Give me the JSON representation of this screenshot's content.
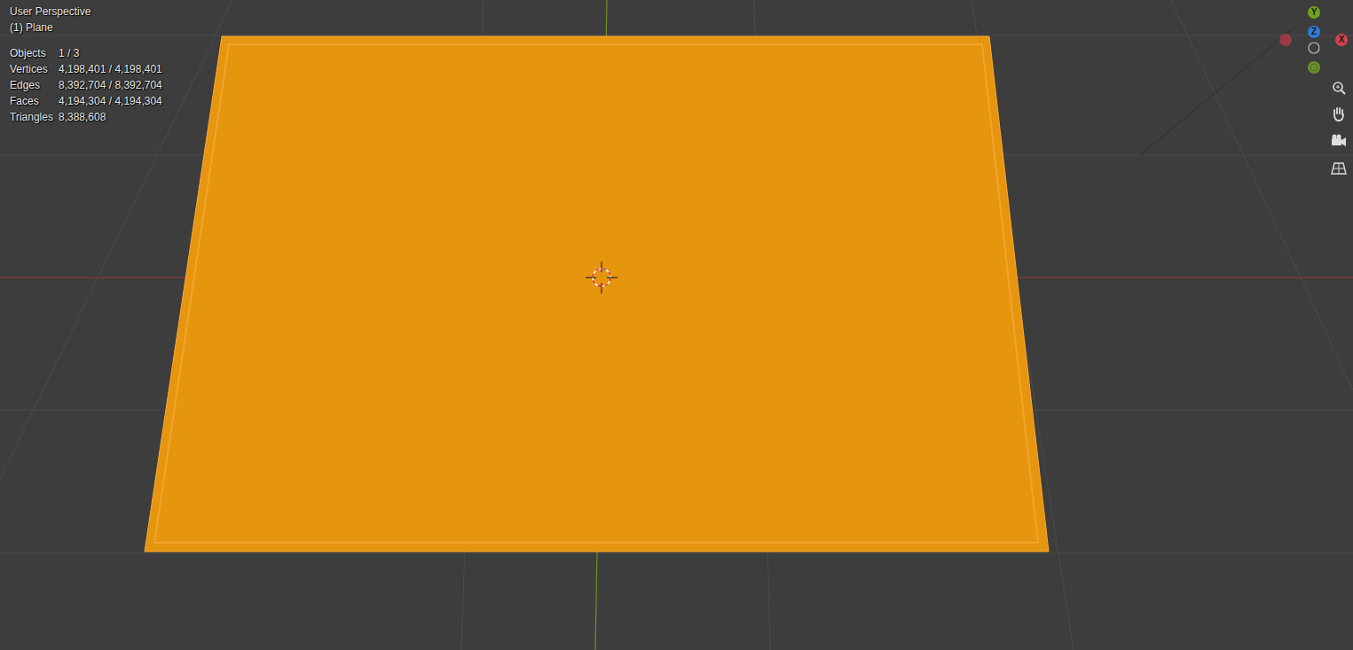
{
  "viewport": {
    "view": "User Perspective",
    "object": "(1) Plane"
  },
  "stats": [
    {
      "label": "Objects",
      "value": "1 / 3"
    },
    {
      "label": "Vertices",
      "value": "4,198,401 / 4,198,401"
    },
    {
      "label": "Edges",
      "value": "8,392,704 / 8,392,704"
    },
    {
      "label": "Faces",
      "value": "4,194,304 / 4,194,304"
    },
    {
      "label": "Triangles",
      "value": "8,388,608"
    }
  ],
  "gizmo": {
    "axes": [
      {
        "label": "Y",
        "color": "#6fa31e"
      },
      {
        "label": "Z",
        "color": "#2f7bd4"
      },
      {
        "label": "X",
        "color": "#d33f4f"
      }
    ]
  },
  "selection": {
    "selected": true
  }
}
